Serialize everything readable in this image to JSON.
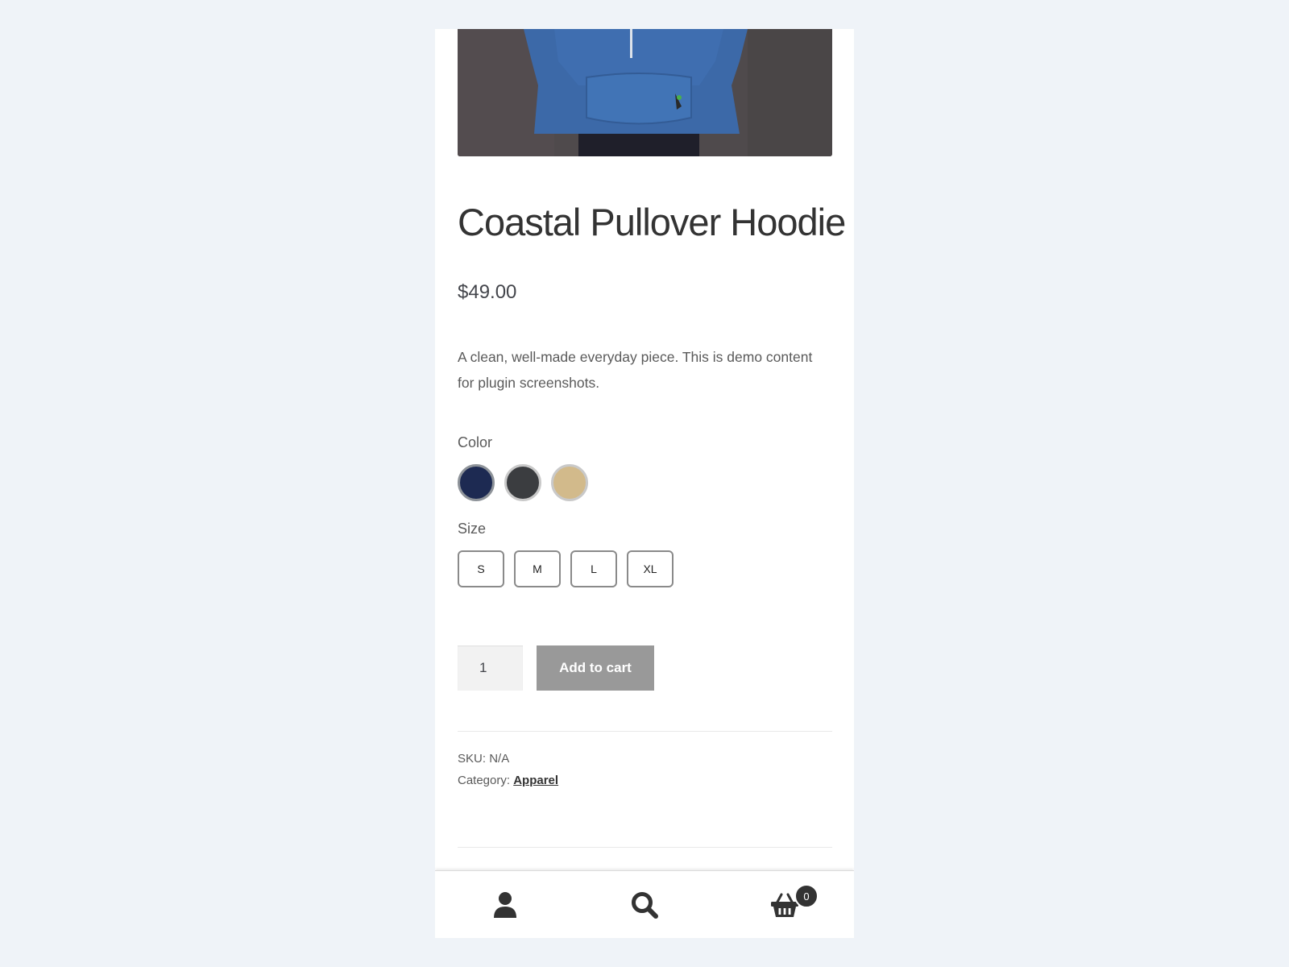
{
  "product": {
    "title": "Coastal Pullover Hoodie",
    "price": "$49.00",
    "description": "A clean, well-made everyday piece. This is demo content for plugin screenshots."
  },
  "attributes": {
    "color_label": "Color",
    "colors": [
      {
        "name": "navy",
        "hex": "#1d2a52"
      },
      {
        "name": "charcoal",
        "hex": "#3b3d40"
      },
      {
        "name": "tan",
        "hex": "#d2ba8b"
      }
    ],
    "size_label": "Size",
    "sizes": [
      "S",
      "M",
      "L",
      "XL"
    ]
  },
  "cart": {
    "quantity": "1",
    "add_to_cart_label": "Add to cart"
  },
  "meta": {
    "sku_label": "SKU:",
    "sku_value": "N/A",
    "category_label": "Category:",
    "category_value": "Apparel"
  },
  "footer": {
    "account_icon": "user-icon",
    "search_icon": "search-icon",
    "cart_icon": "basket-icon",
    "cart_count": "0"
  }
}
